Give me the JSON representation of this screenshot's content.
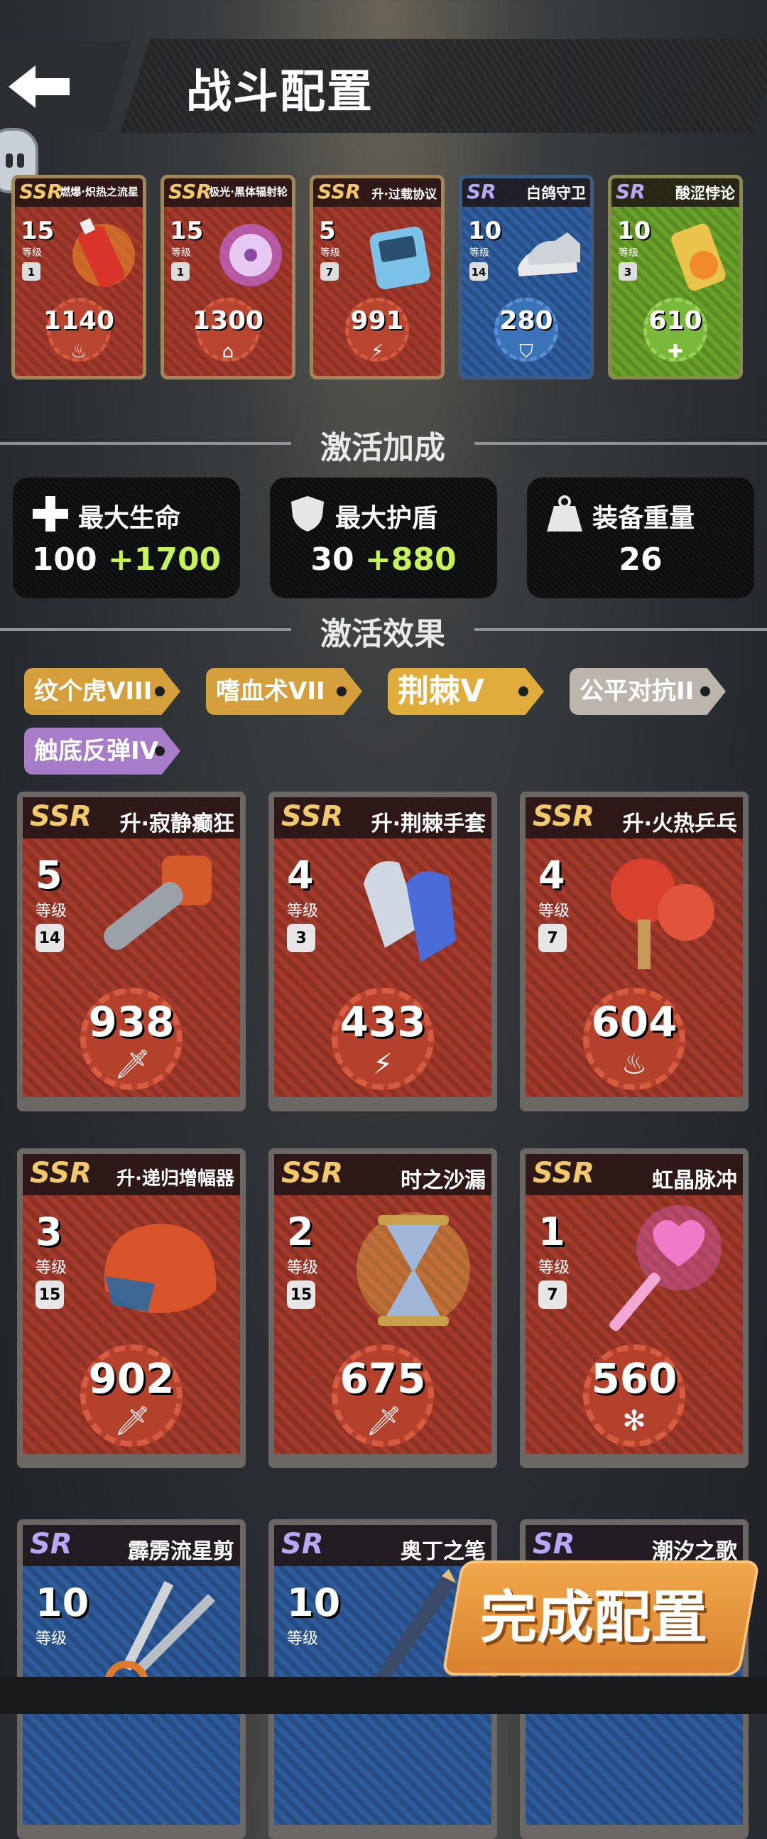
{
  "header": {
    "title": "战斗配置"
  },
  "equipped": [
    {
      "rank": "SSR",
      "name": "燃爆·炽热之流星",
      "level": "15",
      "level_label": "等级",
      "weight": "1",
      "value": "1140",
      "type_icon": "fire-icon",
      "style": "red"
    },
    {
      "rank": "SSR",
      "name": "极光·黑体辐射轮",
      "level": "15",
      "level_label": "等级",
      "weight": "1",
      "value": "1300",
      "type_icon": "drop-icon",
      "style": "red"
    },
    {
      "rank": "SSR",
      "name": "升·过载协议",
      "level": "5",
      "level_label": "等级",
      "weight": "7",
      "value": "991",
      "type_icon": "lightning-icon",
      "style": "red"
    },
    {
      "rank": "SR",
      "name": "白鸽守卫",
      "level": "10",
      "level_label": "等级",
      "weight": "14",
      "value": "280",
      "type_icon": "shield-icon",
      "style": "blue"
    },
    {
      "rank": "SR",
      "name": "酸涩悖论",
      "level": "10",
      "level_label": "等级",
      "weight": "3",
      "value": "610",
      "type_icon": "plus-icon",
      "style": "green"
    }
  ],
  "bonus_section": {
    "title": "激活加成"
  },
  "stats": [
    {
      "label": "最大生命",
      "base": "100",
      "bonus": "+1700",
      "icon": "plus-icon"
    },
    {
      "label": "最大护盾",
      "base": "30",
      "bonus": "+880",
      "icon": "shield-icon"
    },
    {
      "label": "装备重量",
      "base": "26",
      "bonus": "",
      "icon": "weight-icon"
    }
  ],
  "effects_section": {
    "title": "激活效果"
  },
  "effects": [
    {
      "label": "纹个虎VIII",
      "style": "gold"
    },
    {
      "label": "嗜血术VII",
      "style": "gold"
    },
    {
      "label": "荆棘V",
      "style": "gold-bright"
    },
    {
      "label": "公平对抗II",
      "style": "grey"
    },
    {
      "label": "触底反弹IV",
      "style": "purple"
    }
  ],
  "cards": [
    {
      "rank": "SSR",
      "name": "升·寂静癫狂",
      "level": "5",
      "level_label": "等级",
      "weight": "14",
      "value": "938",
      "type_icon": "sword-icon",
      "art": "chainsaw-icon"
    },
    {
      "rank": "SSR",
      "name": "升·荆棘手套",
      "level": "4",
      "level_label": "等级",
      "weight": "3",
      "value": "433",
      "type_icon": "lightning-icon",
      "art": "gloves-icon"
    },
    {
      "rank": "SSR",
      "name": "升·火热乒乓",
      "level": "4",
      "level_label": "等级",
      "weight": "7",
      "value": "604",
      "type_icon": "fire-icon",
      "art": "pingpong-icon"
    },
    {
      "rank": "SSR",
      "name": "升·递归增幅器",
      "level": "3",
      "level_label": "等级",
      "weight": "15",
      "value": "902",
      "type_icon": "sword-icon",
      "art": "helmet-icon"
    },
    {
      "rank": "SSR",
      "name": "时之沙漏",
      "level": "2",
      "level_label": "等级",
      "weight": "15",
      "value": "675",
      "type_icon": "sword-icon",
      "art": "hourglass-icon"
    },
    {
      "rank": "SSR",
      "name": "虹晶脉冲",
      "level": "1",
      "level_label": "等级",
      "weight": "7",
      "value": "560",
      "type_icon": "snowflake-icon",
      "art": "wand-icon"
    },
    {
      "rank": "SR",
      "name": "霹雳流星剪",
      "level": "10",
      "level_label": "等级",
      "weight": "",
      "value": "",
      "type_icon": "",
      "art": "scissors-icon"
    },
    {
      "rank": "SR",
      "name": "奥丁之笔",
      "level": "10",
      "level_label": "等级",
      "weight": "",
      "value": "",
      "type_icon": "",
      "art": "pen-icon"
    },
    {
      "rank": "SR",
      "name": "潮汐之歌",
      "level": "",
      "level_label": "",
      "weight": "",
      "value": "",
      "type_icon": "",
      "art": ""
    }
  ],
  "done_button": {
    "label": "完成配置"
  },
  "colors": {
    "bonus": "#c8f25a",
    "ssr": "#f1c96a",
    "sr": "#b9a6f5",
    "accent": "#e09a3e"
  }
}
